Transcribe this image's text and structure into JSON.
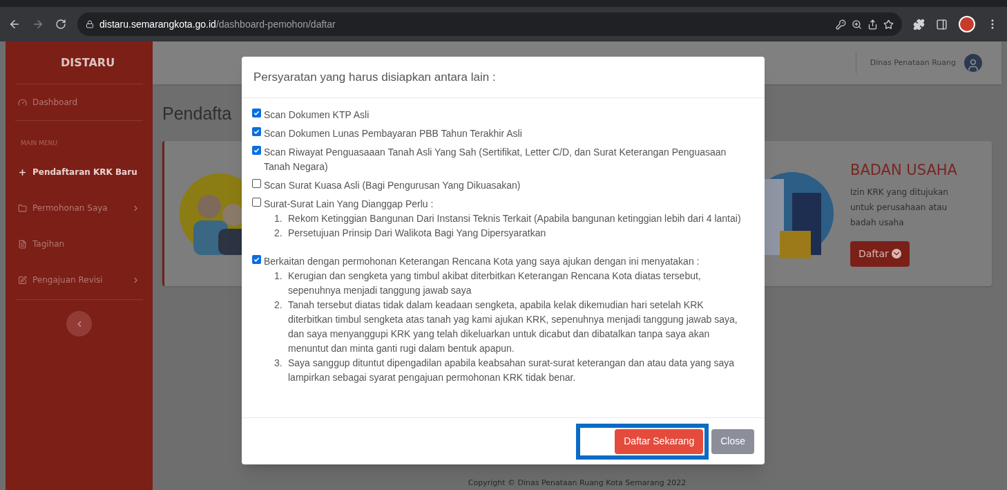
{
  "browser": {
    "url_host": "distaru.semarangkota.go.id",
    "url_path": "/dashboard-pemohon/daftar"
  },
  "sidebar": {
    "brand": "DISTARU",
    "items": [
      {
        "kind": "link",
        "label": "Dashboard",
        "selected": false,
        "expandable": false
      },
      {
        "kind": "heading",
        "label": "MAIN MENU"
      },
      {
        "kind": "link",
        "label": "Pendaftaran KRK Baru",
        "selected": true,
        "expandable": false
      },
      {
        "kind": "link",
        "label": "Permohonan Saya",
        "selected": false,
        "expandable": true
      },
      {
        "kind": "link",
        "label": "Tagihan",
        "selected": false,
        "expandable": false
      },
      {
        "kind": "link",
        "label": "Pengajuan Revisi",
        "selected": false,
        "expandable": true
      }
    ]
  },
  "header": {
    "user": "Dinas Penataan Ruang"
  },
  "page": {
    "title": "Pendafta",
    "card": {
      "title": "BADAN USAHA",
      "description": "Izin KRK yang ditujukan untuk perusahaan atau badah usaha",
      "button": "Daftar"
    },
    "footer": "Copyright © Dinas Penataan Ruang Kota Semarang 2022"
  },
  "modal": {
    "title": "Persyaratan yang harus disiapkan antara lain :",
    "requirements": [
      {
        "label": "Scan Dokumen KTP Asli",
        "checked": true
      },
      {
        "label": "Scan Dokumen Lunas Pembayaran PBB Tahun Terakhir Asli",
        "checked": true
      },
      {
        "label": "Scan Riwayat Penguasaaan Tanah Asli Yang Sah (Sertifikat, Letter C/D, dan Surat Keterangan Penguasaan Tanah Negara)",
        "checked": true
      },
      {
        "label": "Scan Surat Kuasa Asli (Bagi Pengurusan Yang Dikuasakan)",
        "checked": false
      },
      {
        "label": "Surat-Surat Lain Yang Dianggap Perlu :",
        "checked": false,
        "subitems": [
          {
            "number": "1.",
            "text": "Rekom Ketinggian Bangunan Dari Instansi Teknis Terkait (Apabila bangunan ketinggian lebih dari 4 lantai)"
          },
          {
            "number": "2.",
            "text": "Persetujuan Prinsip Dari Walikota Bagi Yang Dipersyaratkan"
          }
        ]
      },
      {
        "label": "Berkaitan dengan permohonan Keterangan Rencana Kota yang saya ajukan dengan ini menyatakan :",
        "checked": true,
        "subitems": [
          {
            "number": "1.",
            "text": "Kerugian dan sengketa yang timbul akibat diterbitkan Keterangan Rencana Kota diatas tersebut, sepenuhnya menjadi tanggung jawab saya"
          },
          {
            "number": "2.",
            "text": "Tanah tersebut diatas tidak dalam keadaan sengketa, apabila kelak dikemudian hari setelah KRK diterbitkan timbul sengketa atas tanah yag kami ajukan KRK, sepenuhnya menjadi tanggung jawab saya, dan saya menyanggupi KRK yang telah dikeluarkan untuk dicabut dan dibatalkan tanpa saya akan menuntut dan minta ganti rugi dalam bentuk apapun."
          },
          {
            "number": "3.",
            "text": "Saya sanggup dituntut dipengadilan apabila keabsahan surat-surat keterangan dan atau data yang saya lampirkan sebagai syarat pengajuan permohonan KRK tidak benar."
          }
        ]
      }
    ],
    "buttons": [
      {
        "kind": "primary",
        "label": "Daftar Sekarang",
        "highlighted": true
      },
      {
        "kind": "secondary",
        "label": "Close",
        "highlighted": false
      }
    ]
  }
}
